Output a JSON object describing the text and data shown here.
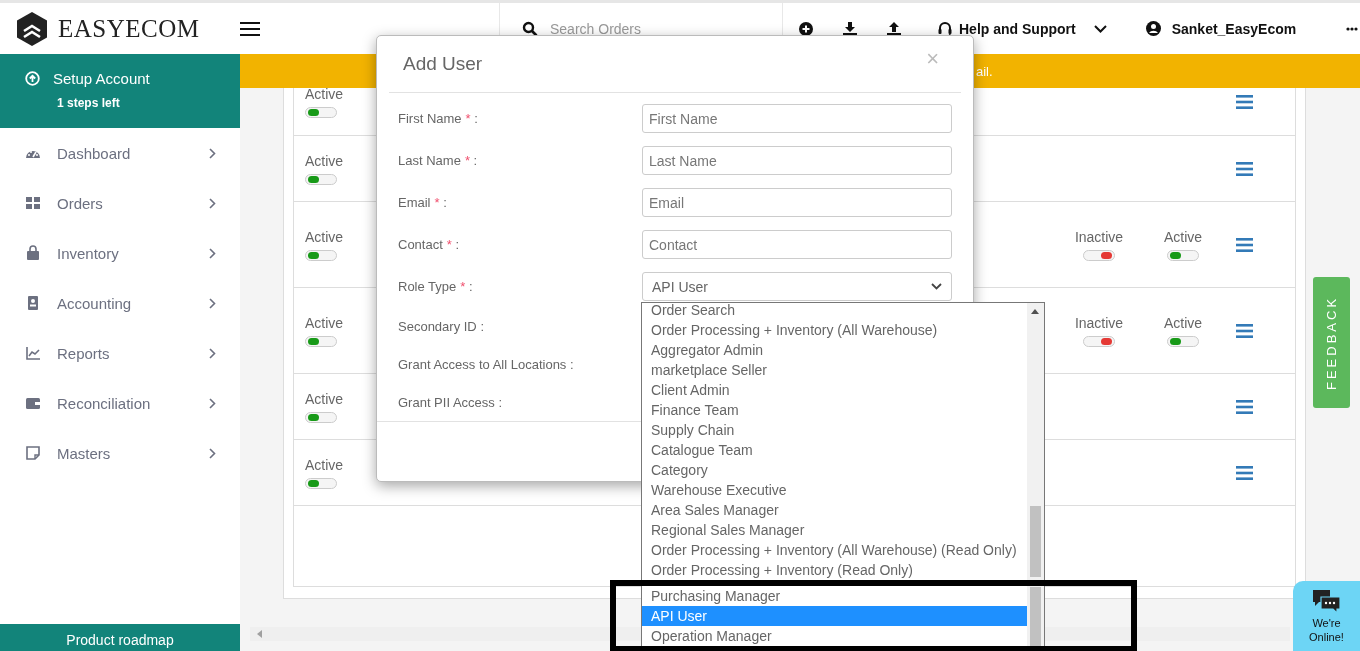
{
  "header": {
    "brand": "EASYECOM",
    "search": {
      "placeholder": "Search Orders"
    },
    "help": "Help and Support",
    "user": "Sanket_EasyEcom"
  },
  "sidebar": {
    "setup": {
      "title": "Setup Account",
      "subtitle": "1 steps left"
    },
    "items": [
      {
        "label": "Dashboard"
      },
      {
        "label": "Orders"
      },
      {
        "label": "Inventory"
      },
      {
        "label": "Accounting"
      },
      {
        "label": "Reports"
      },
      {
        "label": "Reconciliation"
      },
      {
        "label": "Masters"
      }
    ],
    "footer": "Product roadmap"
  },
  "banner": {
    "text": "ail."
  },
  "table": {
    "rows": [
      {
        "status": {
          "label": "Active",
          "on": true
        },
        "extra": []
      },
      {
        "status": {
          "label": "Active",
          "on": true
        },
        "extra": []
      },
      {
        "status": {
          "label": "Active",
          "on": true
        },
        "extra": [
          {
            "label": "Inactive",
            "on": false
          },
          {
            "label": "Active",
            "on": true
          }
        ]
      },
      {
        "status": {
          "label": "Active",
          "on": true
        },
        "extra": [
          {
            "label": "Inactive",
            "on": false
          },
          {
            "label": "Active",
            "on": true
          }
        ]
      },
      {
        "status": {
          "label": "Active",
          "on": true
        },
        "extra": []
      },
      {
        "status": {
          "label": "Active",
          "on": true
        },
        "extra": []
      }
    ]
  },
  "modal": {
    "title": "Add User",
    "close": "×",
    "required_mark": "*",
    "separator": ":",
    "fields": [
      {
        "label": "First Name",
        "required": true,
        "kind": "text",
        "placeholder": "First Name"
      },
      {
        "label": "Last Name",
        "required": true,
        "kind": "text",
        "placeholder": "Last Name"
      },
      {
        "label": "Email",
        "required": true,
        "kind": "text",
        "placeholder": "Email"
      },
      {
        "label": "Contact",
        "required": true,
        "kind": "text",
        "placeholder": "Contact"
      },
      {
        "label": "Role Type",
        "required": true,
        "kind": "select",
        "value": "API User"
      },
      {
        "label": "Secondary ID",
        "required": false,
        "kind": "label"
      },
      {
        "label": "Grant Access to All Locations",
        "required": false,
        "kind": "label"
      },
      {
        "label": "Grant PII Access",
        "required": false,
        "kind": "label"
      }
    ]
  },
  "dropdown": {
    "options": [
      {
        "label": "Order Search",
        "selected": false
      },
      {
        "label": "Order Processing + Inventory (All Warehouse)",
        "selected": false
      },
      {
        "label": "Aggregator Admin",
        "selected": false
      },
      {
        "label": "marketplace Seller",
        "selected": false
      },
      {
        "label": "Client Admin",
        "selected": false
      },
      {
        "label": "Finance Team",
        "selected": false
      },
      {
        "label": "Supply Chain",
        "selected": false
      },
      {
        "label": "Catalogue Team",
        "selected": false
      },
      {
        "label": "Category",
        "selected": false
      },
      {
        "label": "Warehouse Executive",
        "selected": false
      },
      {
        "label": "Area Sales Manager",
        "selected": false
      },
      {
        "label": "Regional Sales Manager",
        "selected": false
      },
      {
        "label": "Order Processing + Inventory (All Warehouse) (Read Only)",
        "selected": false
      },
      {
        "label": "Order Processing + Inventory (Read Only)",
        "selected": false
      },
      {
        "label": "Purchasing Manager",
        "selected": false
      },
      {
        "label": "API User",
        "selected": true
      },
      {
        "label": "Operation Manager",
        "selected": false
      }
    ]
  },
  "feedback": "FEEDBACK",
  "chat": "We're Online!",
  "annotation": {
    "kind": "frame"
  }
}
